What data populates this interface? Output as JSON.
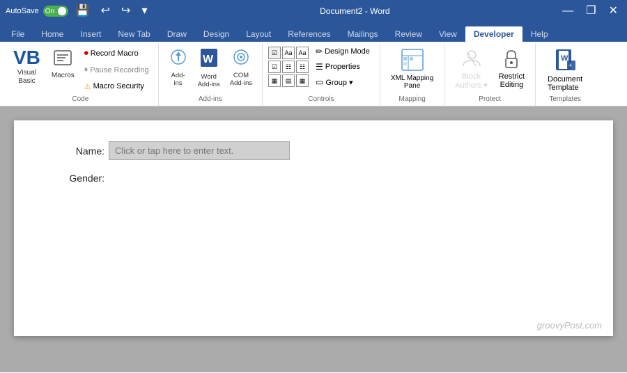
{
  "titleBar": {
    "autosave": "AutoSave",
    "autosave_state": "On",
    "save_icon": "💾",
    "undo_icon": "↩",
    "redo_icon": "↪",
    "title": "Document2 - Word",
    "minimize": "—",
    "restore": "❐",
    "close": "✕"
  },
  "tabs": [
    {
      "label": "File",
      "active": false
    },
    {
      "label": "Home",
      "active": false
    },
    {
      "label": "Insert",
      "active": false
    },
    {
      "label": "New Tab",
      "active": false
    },
    {
      "label": "Draw",
      "active": false
    },
    {
      "label": "Design",
      "active": false
    },
    {
      "label": "Layout",
      "active": false
    },
    {
      "label": "References",
      "active": false
    },
    {
      "label": "Mailings",
      "active": false
    },
    {
      "label": "Review",
      "active": false
    },
    {
      "label": "View",
      "active": false
    },
    {
      "label": "Developer",
      "active": true
    },
    {
      "label": "Help",
      "active": false
    }
  ],
  "ribbon": {
    "groups": [
      {
        "name": "code",
        "label": "Code",
        "items": [
          {
            "id": "visual-basic",
            "label": "Visual\nBasic",
            "icon": "VB"
          },
          {
            "id": "macros",
            "label": "Macros",
            "icon": "▤"
          },
          {
            "id": "record-macro",
            "label": "Record Macro"
          },
          {
            "id": "pause-recording",
            "label": "⏸ Pause Recording"
          },
          {
            "id": "macro-security",
            "label": "Macro Security",
            "has_warning": true
          }
        ]
      },
      {
        "name": "add-ins",
        "label": "Add-ins",
        "items": [
          {
            "id": "add-ins",
            "label": "Add-\nins",
            "icon": "◈"
          },
          {
            "id": "word-add-ins",
            "label": "Word\nAdd-ins",
            "icon": "W"
          },
          {
            "id": "com-add-ins",
            "label": "COM\nAdd-ins",
            "icon": "⚙"
          }
        ]
      },
      {
        "name": "controls",
        "label": "Controls",
        "items": [
          {
            "id": "design-mode",
            "label": "Design Mode"
          },
          {
            "id": "properties",
            "label": "Properties"
          },
          {
            "id": "group",
            "label": "▼ Group"
          }
        ]
      },
      {
        "name": "mapping",
        "label": "Mapping",
        "items": [
          {
            "id": "xml-mapping-pane",
            "label": "XML Mapping\nPane"
          }
        ]
      },
      {
        "name": "protect",
        "label": "Protect",
        "items": [
          {
            "id": "block-authors",
            "label": "Block\nAuthors",
            "disabled": true
          },
          {
            "id": "restrict-editing",
            "label": "Restrict\nEditing"
          }
        ]
      },
      {
        "name": "templates",
        "label": "Templates",
        "items": [
          {
            "id": "document-template",
            "label": "Document\nTemplate"
          }
        ]
      }
    ]
  },
  "document": {
    "fields": [
      {
        "label": "Name:",
        "placeholder": "Click or tap here to enter text.",
        "type": "text-input"
      },
      {
        "label": "Gender:",
        "placeholder": "",
        "type": "text-plain"
      }
    ],
    "watermark": "groovyPost.com"
  }
}
